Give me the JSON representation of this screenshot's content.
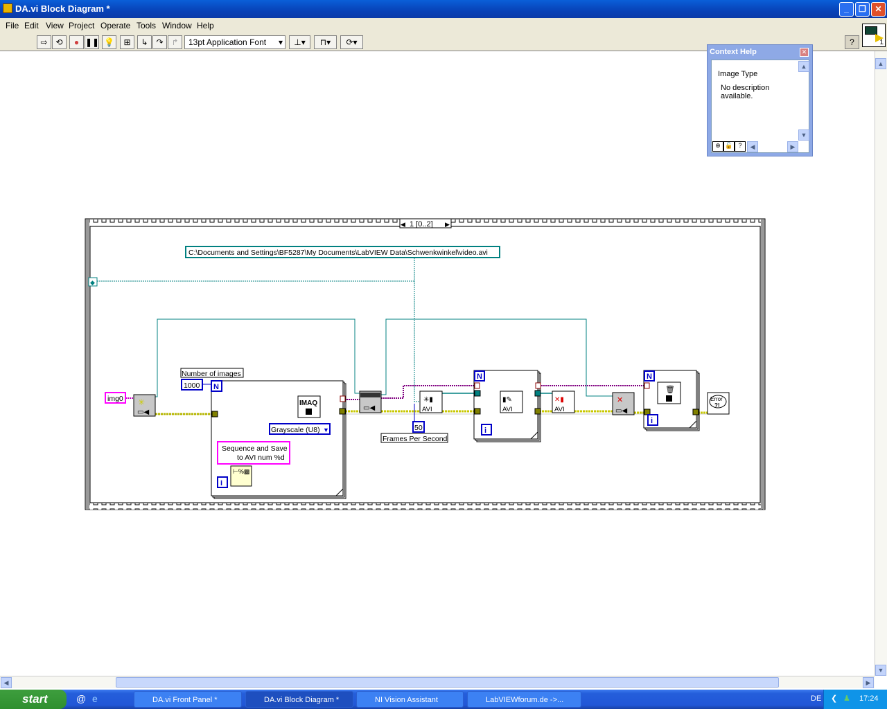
{
  "window": {
    "title": "DA.vi Block Diagram *"
  },
  "menu": [
    "File",
    "Edit",
    "View",
    "Project",
    "Operate",
    "Tools",
    "Window",
    "Help"
  ],
  "toolbar": {
    "font": "13pt Application Font",
    "icons": [
      "run-arrow",
      "run-continuously",
      "abort",
      "pause",
      "highlight-execution",
      "retain-wire-values",
      "step-into",
      "step-over",
      "step-out",
      "align-objects",
      "distribute-objects",
      "reorder"
    ],
    "help": "?",
    "vi_icon_number": "1"
  },
  "context_help": {
    "title": "Context Help",
    "heading": "Image Type",
    "description": "No description available."
  },
  "diagram": {
    "sequence_selector": "1 [0..2]",
    "path_constant": "C:\\Documents and Settings\\BF5287\\My Documents\\LabVIEW Data\\Schwenkwinkel\\video.avi",
    "image_name": "img0",
    "number_of_images_label": "Number of images",
    "number_of_images": "1000",
    "loop_count": "N",
    "loop_index": "i",
    "imaq_label": "IMAQ",
    "image_type": "Grayscale (U8)",
    "format_string": "Sequence and Save to AVI num %d",
    "format_string_line1": "Sequence and Save",
    "format_string_line2": "to AVI num %d",
    "avi_label": "AVI",
    "fps_value": "50",
    "fps_label": "Frames Per Second",
    "error_label": "Error",
    "error_mark": "?!",
    "wire_colors": {
      "path": "#008080",
      "error": "#c8c800",
      "image": "#800080",
      "string": "#ff00ff",
      "numeric": "#0000c8"
    }
  },
  "taskbar": {
    "start": "start",
    "items": [
      "DA.vi Front Panel *",
      "DA.vi Block Diagram *",
      "NI Vision Assistant",
      "LabVIEWforum.de ->..."
    ],
    "active": 1,
    "lang": "DE",
    "clock": "17:24"
  }
}
